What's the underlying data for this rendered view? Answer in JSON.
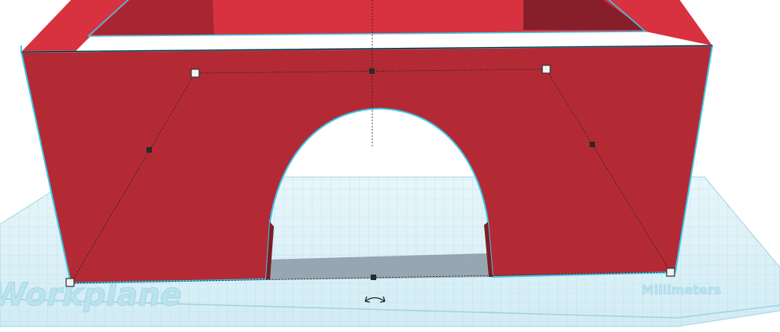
{
  "workplane": {
    "label": "Workplane",
    "units_label": "Millimeters",
    "grid_color": "#7fc7dd",
    "fill_color": "#dbeff6"
  },
  "shape": {
    "name": "Red box with arch opening",
    "front_color": "#b32a35",
    "top_color": "#d8313f",
    "inner_dark_color": "#861f29",
    "selection_outline_color": "#3cc6e8"
  },
  "handles": {
    "corner_handle_color": "#f2f2f2",
    "midpoint_handle_color": "#2a2a2a",
    "rotate_icon": "rotate-arrow-icon"
  }
}
